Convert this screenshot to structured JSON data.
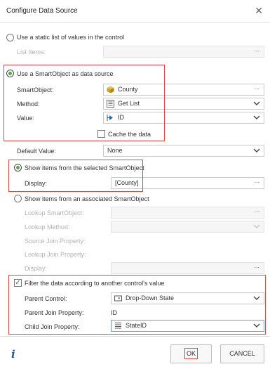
{
  "dialog": {
    "title": "Configure Data Source"
  },
  "static_option": {
    "label": "Use a static list of values in the control",
    "list_items_label": "List Items:"
  },
  "smartobject_option": {
    "label": "Use a SmartObject as data source",
    "smartobject_label": "SmartObject:",
    "smartobject_value": "County",
    "method_label": "Method:",
    "method_value": "Get List",
    "value_label": "Value:",
    "value_value": "ID",
    "cache_label": "Cache the data"
  },
  "default_value": {
    "label": "Default Value:",
    "value": "None"
  },
  "show_selected": {
    "label": "Show items from the selected SmartObject",
    "display_label": "Display:",
    "display_value": "[County]"
  },
  "show_associated": {
    "label": "Show items from an associated SmartObject",
    "lookup_smartobject_label": "Lookup SmartObject:",
    "lookup_method_label": "Lookup Method:",
    "source_join_label": "Source Join Property:",
    "lookup_join_label": "Lookup Join Property:",
    "display_label": "Display:"
  },
  "filter": {
    "label": "Filter the data according to another control's value",
    "parent_control_label": "Parent Control:",
    "parent_control_value": "Drop-Down State",
    "parent_join_label": "Parent Join Property:",
    "parent_join_value": "ID",
    "child_join_label": "Child Join Property:",
    "child_join_value": "StateID"
  },
  "footer": {
    "ok_label": "OK",
    "cancel_label": "CANCEL"
  },
  "icons": {
    "close": "close-icon",
    "smartobject": "smartobject-icon",
    "method": "method-icon",
    "property": "property-icon",
    "control": "dropdown-control-icon",
    "list": "list-icon",
    "info": "info-icon"
  },
  "colors": {
    "highlight": "#e0443e",
    "radio_selected": "#55a546",
    "info": "#1a5aa8"
  }
}
